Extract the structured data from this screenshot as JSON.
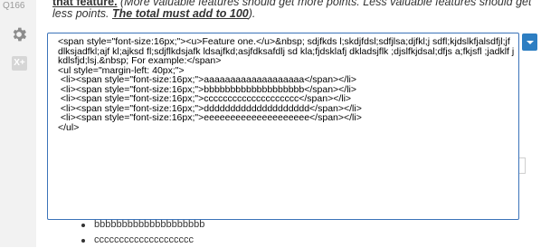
{
  "question": {
    "number": "Q166",
    "prefix": "that feature.",
    "italic_text": " (More valuable features should get more points.  Less valuable features should get less points. ",
    "emphasis": "The total must add to 100",
    "suffix": ")."
  },
  "rail": {
    "gear_icon": "gear-icon",
    "x_label": "X+"
  },
  "editor": {
    "content": "<span style=\"font-size:16px;\"><u>Feature one.</u>&nbsp; sdjfkds l;skdjfdsl;sdfjlsa;djfkl;j sdfl;kjdslkfjalsdfjl;jfdlksjadfkl;ajf kl;ajksd fl;sdjflkdsjafk ldsajfkd;asjfdksafdlj sd kla;fjdsklafj dkladsjflk ;djslfkjdsal;dfjs a;fkjsfl ;jadklf jkdlsfjd;lsj.&nbsp; For example:</span>\n<ul style=\"margin-left: 40px;\">\n <li><span style=\"font-size:16px;\">aaaaaaaaaaaaaaaaaaa</span></li>\n <li><span style=\"font-size:16px;\">bbbbbbbbbbbbbbbbbbb</span></li>\n <li><span style=\"font-size:16px;\">cccccccccccccccccccc</span></li>\n <li><span style=\"font-size:16px;\">dddddddddddddddddddd</span></li>\n <li><span style=\"font-size:16px;\">eeeeeeeeeeeeeeeeeeee</span></li>\n</ul>"
  },
  "background_list": [
    "bbbbbbbbbbbbbbbbbbbb",
    "cccccccccccccccccccc"
  ],
  "colors": {
    "accent": "#2d7ec2",
    "editor_border": "#3b73b9"
  }
}
